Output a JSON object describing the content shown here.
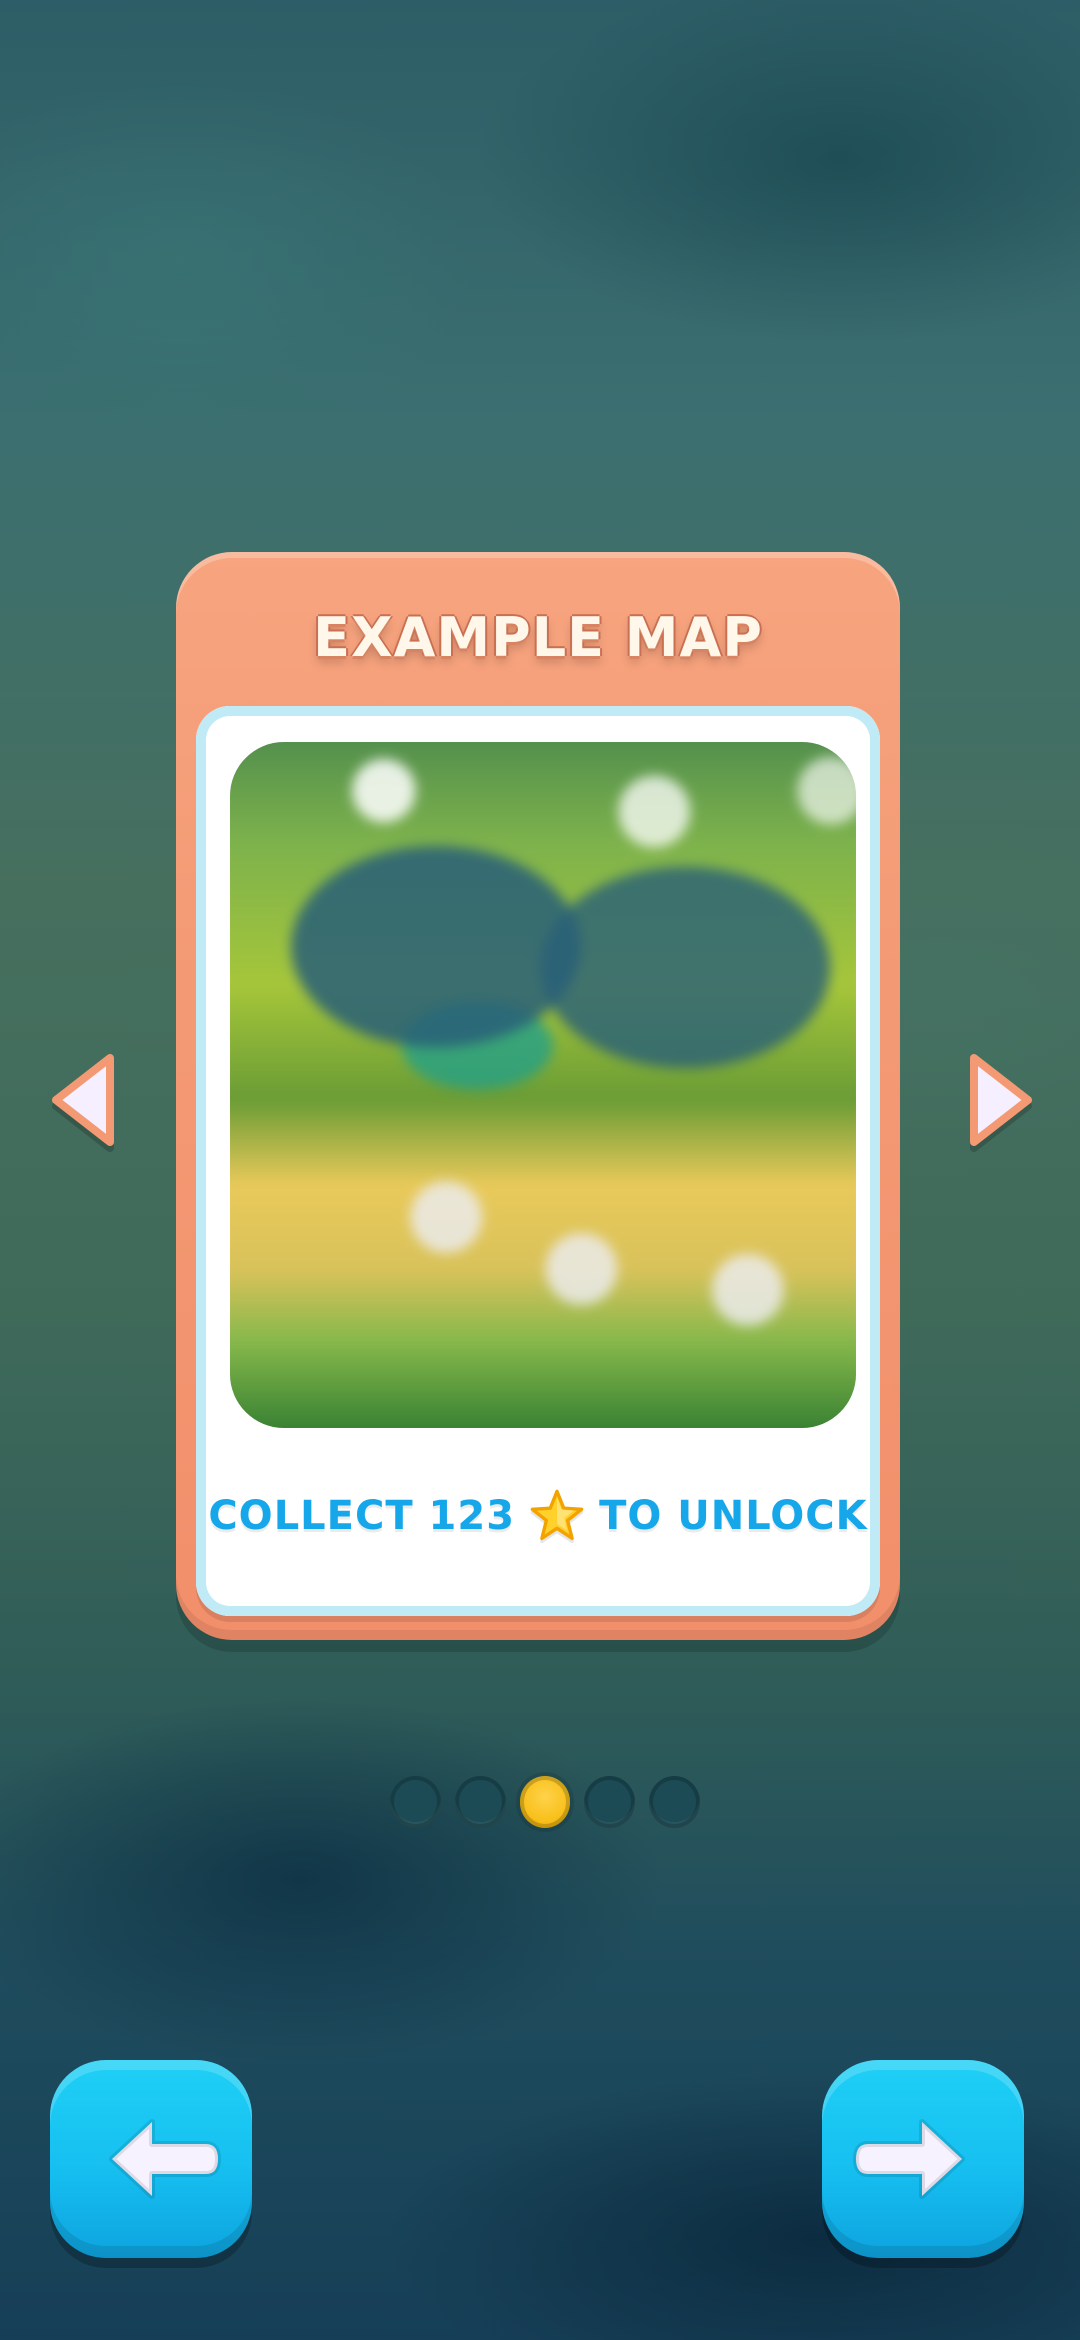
{
  "colors": {
    "card_orange": "#F39A74",
    "card_inner_white": "#FFFFFF",
    "accent_blue": "#16A7EA",
    "button_cyan": "#16BFF0",
    "dot_inactive": "#1C4B55",
    "dot_active": "#F8C01B"
  },
  "card": {
    "title": "EXAMPLE MAP",
    "unlock_prefix": "COLLECT 123",
    "unlock_suffix": "TO UNLOCK",
    "unlock_icon": "star-icon"
  },
  "carousel": {
    "page_count": 5,
    "active_index": 2
  },
  "buttons": {
    "prev_icon": "left-arrow-icon",
    "next_icon": "right-arrow-icon"
  }
}
